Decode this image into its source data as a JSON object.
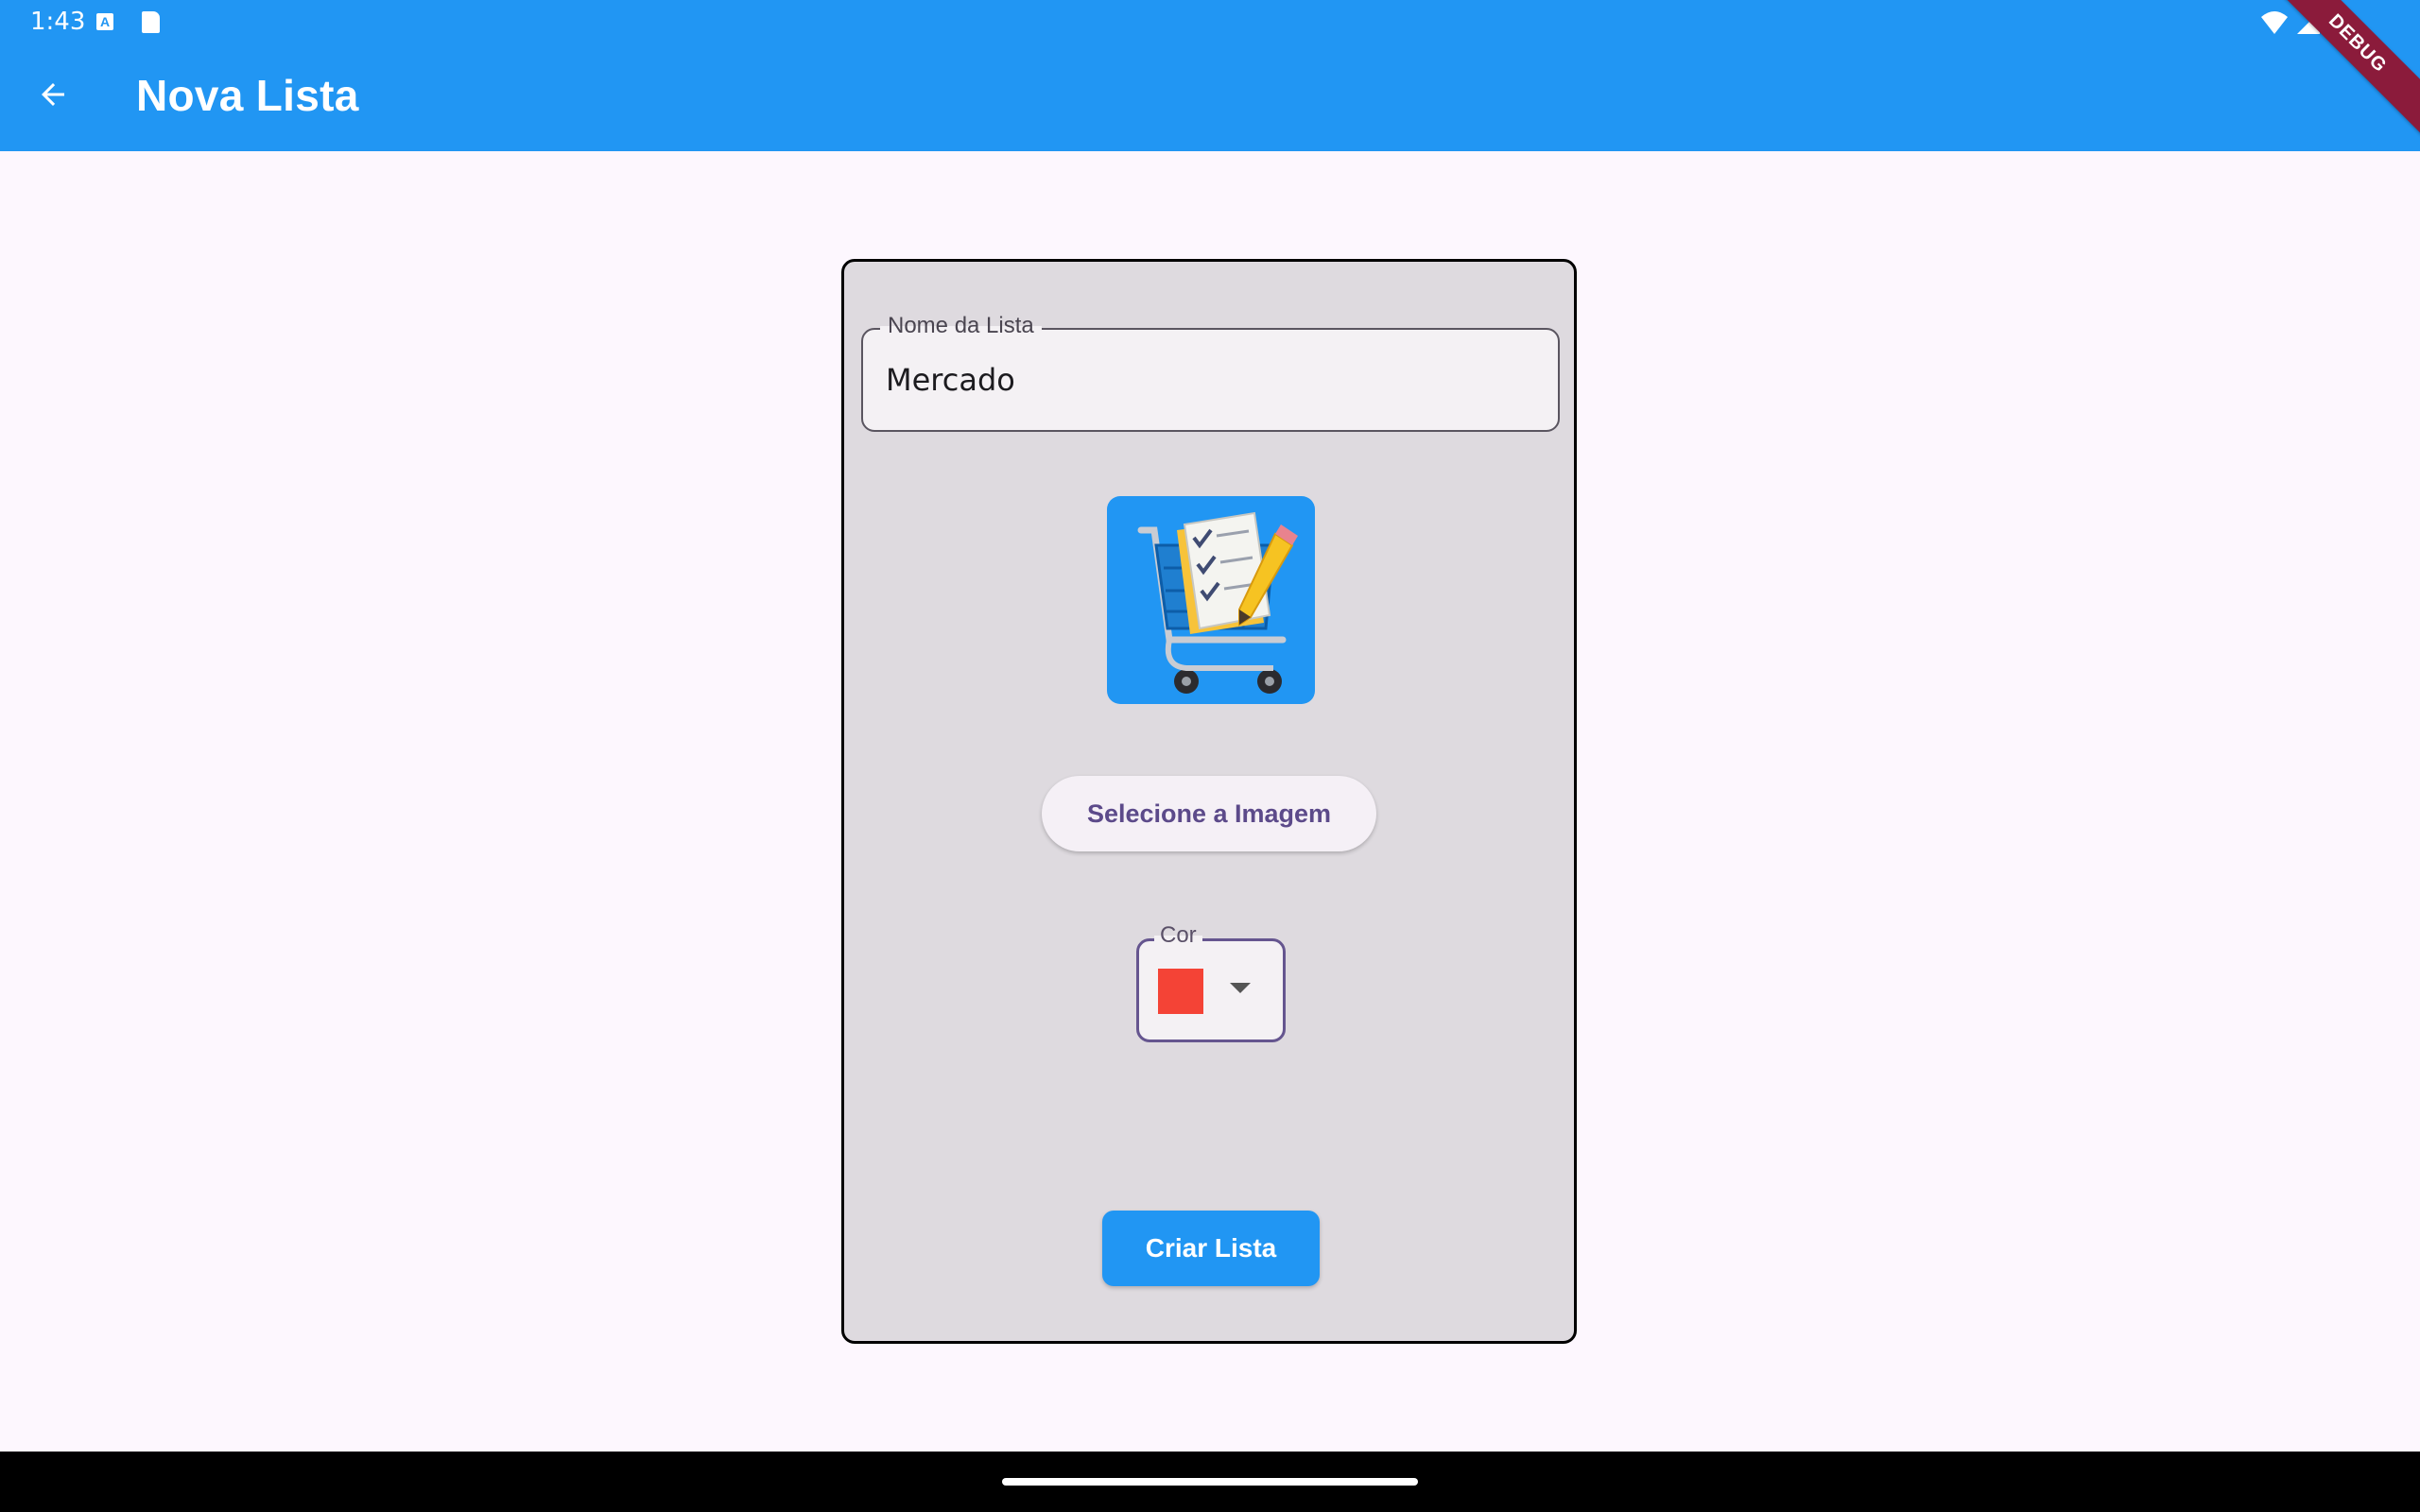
{
  "status_bar": {
    "time": "1:43",
    "keyboard_indicator": "A",
    "icons": [
      "keyboard-icon",
      "sd-card-icon",
      "wifi-icon",
      "cell-signal-icon",
      "battery-icon"
    ]
  },
  "app_bar": {
    "title": "Nova Lista",
    "back_icon": "arrow-back-icon",
    "background": "#2196f3",
    "debug_banner": "DEBUG"
  },
  "form": {
    "name_field": {
      "label": "Nome da Lista",
      "value": "Mercado"
    },
    "image": {
      "description_icon": "shopping-cart-checklist-icon",
      "background": "#2196f3"
    },
    "select_image_button": "Selecione a Imagem",
    "color_field": {
      "label": "Cor",
      "selected_color": "#f44336"
    },
    "create_button": "Criar Lista"
  },
  "colors": {
    "accent": "#2196f3",
    "page_background": "#fdf7fe",
    "card_background": "#dedadf",
    "outline_focus": "#65558f"
  }
}
